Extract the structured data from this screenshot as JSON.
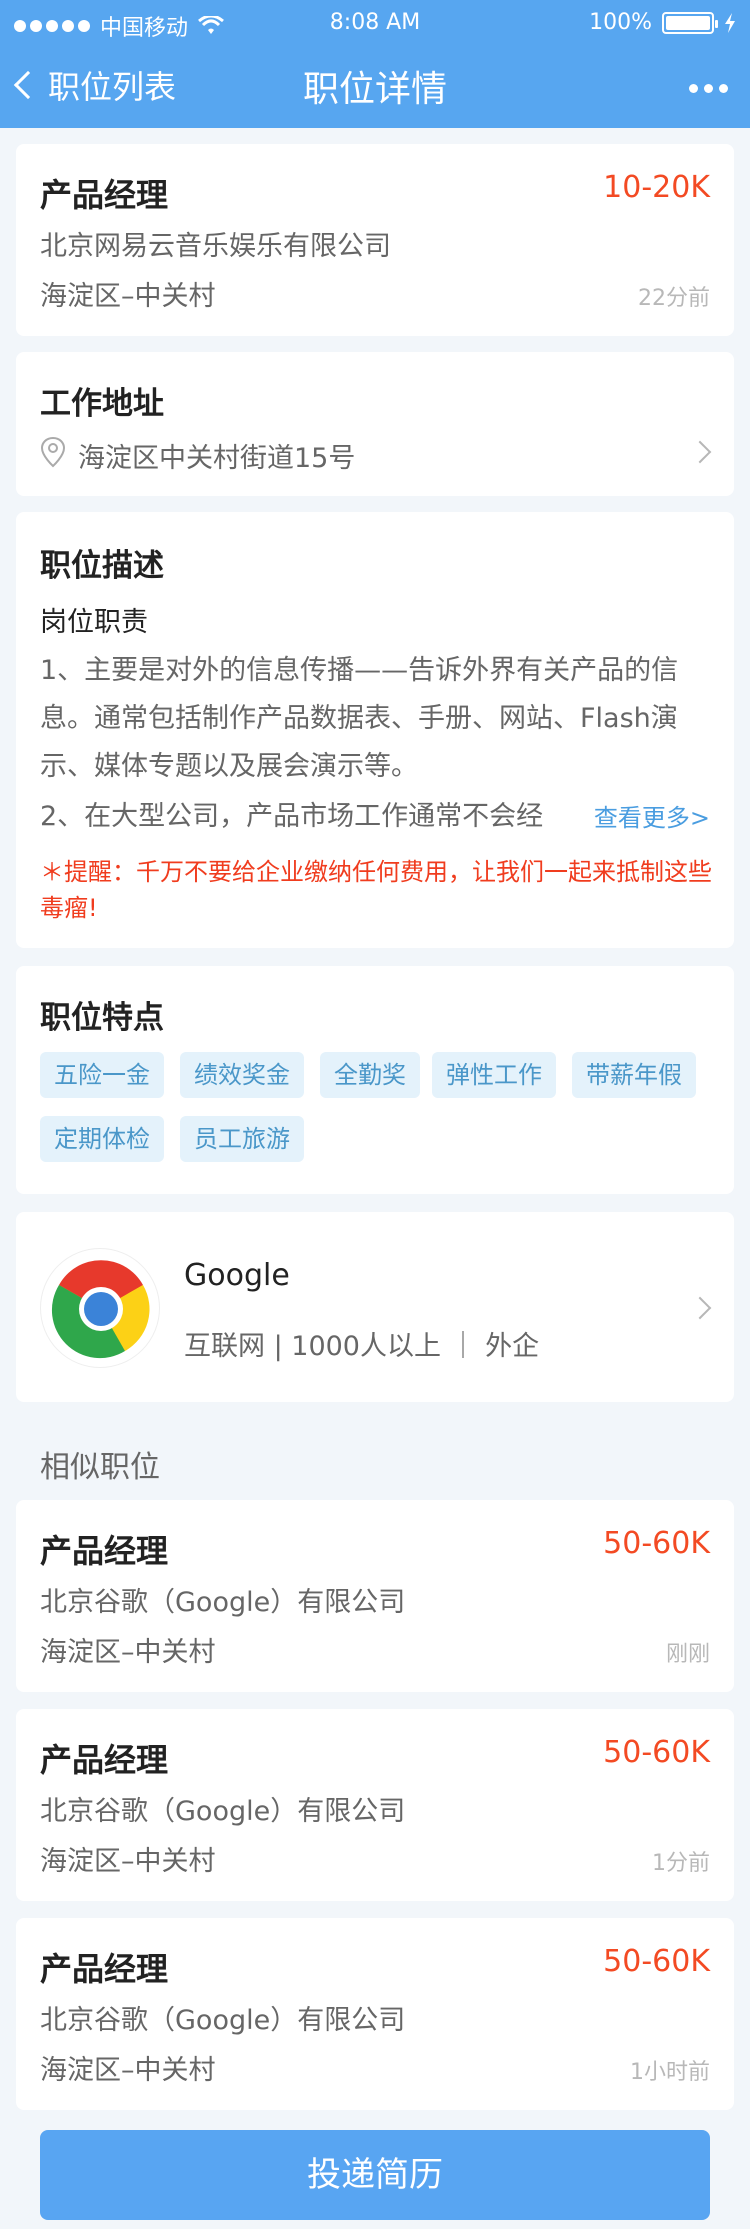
{
  "status_bar": {
    "carrier": "中国移动",
    "time": "8:08 AM",
    "battery": "100%"
  },
  "nav": {
    "back_label": "职位列表",
    "title": "职位详情"
  },
  "job": {
    "title": "产品经理",
    "salary": "10-20K",
    "company": "北京网易云音乐娱乐有限公司",
    "area": "海淀区–中关村",
    "posted": "22分前"
  },
  "address": {
    "heading": "工作地址",
    "text": "海淀区中关村街道15号"
  },
  "description": {
    "heading": "职位描述",
    "subheading": "岗位职责",
    "line1": "1、主要是对外的信息传播——告诉外界有关产品的信",
    "line2": "息。通常包括制作产品数据表、手册、网站、Flash演",
    "line3": "示、媒体专题以及展会演示等。",
    "line4": "2、在大型公司，产品市场工作通常不会经",
    "more": "查看更多>",
    "warning1": "＊提醒：千万不要给企业缴纳任何费用，让我们一起来抵制这些",
    "warning2": "毒瘤!"
  },
  "features": {
    "heading": "职位特点",
    "tags": [
      "五险一金",
      "绩效奖金",
      "全勤奖",
      "弹性工作",
      "带薪年假",
      "定期体检",
      "员工旅游"
    ]
  },
  "company_card": {
    "name": "Google",
    "info": "互联网 | 1000人以上 ｜ 外企"
  },
  "similar": {
    "heading": "相似职位",
    "items": [
      {
        "title": "产品经理",
        "salary": "50-60K",
        "company": "北京谷歌（Google）有限公司",
        "area": "海淀区–中关村",
        "posted": "刚刚"
      },
      {
        "title": "产品经理",
        "salary": "50-60K",
        "company": "北京谷歌（Google）有限公司",
        "area": "海淀区–中关村",
        "posted": "1分前"
      },
      {
        "title": "产品经理",
        "salary": "50-60K",
        "company": "北京谷歌（Google）有限公司",
        "area": "海淀区–中关村",
        "posted": "1小时前"
      }
    ]
  },
  "submit": {
    "label": "投递简历"
  },
  "colors": {
    "primary": "#57a6f0",
    "salary": "#f34a23",
    "link": "#4a9de0",
    "warning": "#f03c1e",
    "tag_bg": "#e4f2fb",
    "tag_text": "#4a97c9"
  }
}
